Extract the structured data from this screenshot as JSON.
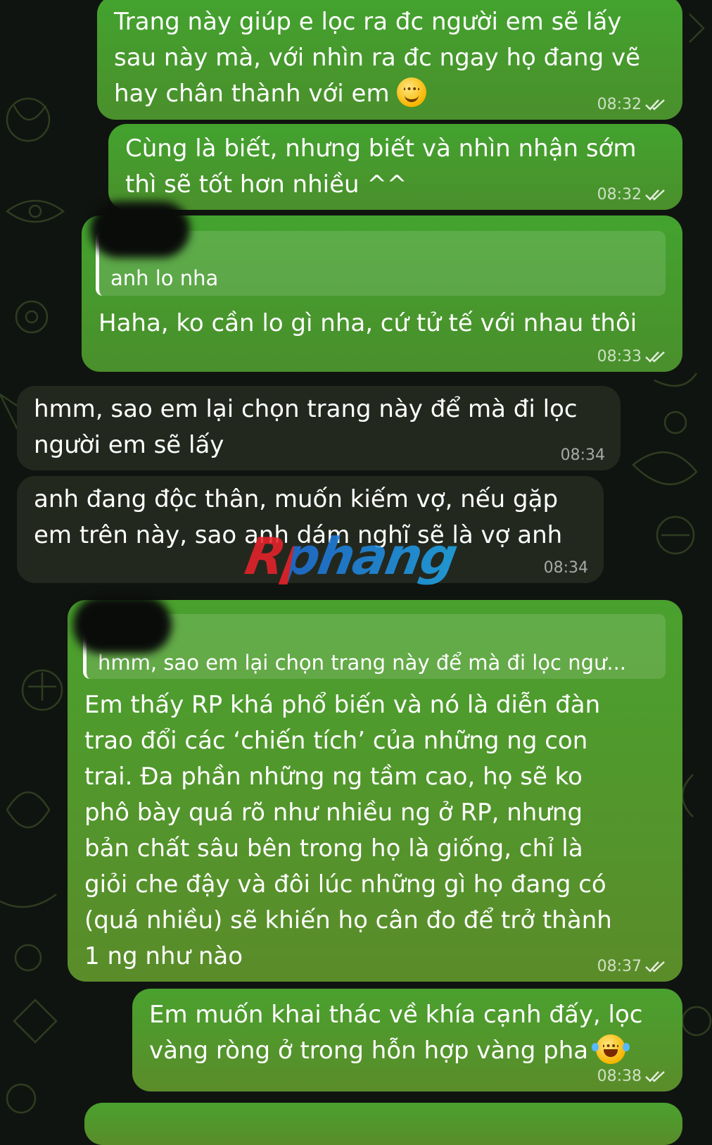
{
  "messages": [
    {
      "id": "m1",
      "direction": "outgoing",
      "text": "Trang này giúp e lọc ra đc người em sẽ lấy\nsau này mà, với nhìn ra đc ngay họ đang vẽ\nhay chân thành với em",
      "emoji": "smiling-face-icon",
      "time": "08:32",
      "status": "read"
    },
    {
      "id": "m2",
      "direction": "outgoing",
      "text": "Cùng là biết, nhưng biết và nhìn nhận sớm\nthì sẽ tốt hơn nhiều ^^",
      "time": "08:32",
      "status": "read"
    },
    {
      "id": "m3",
      "direction": "outgoing",
      "reply_to": "anh lo nha",
      "text": "Haha, ko cần lo gì nha, cứ tử tế với nhau thôi",
      "time": "08:33",
      "status": "read"
    },
    {
      "id": "m4",
      "direction": "incoming",
      "text": "hmm, sao em lại chọn trang này để mà đi lọc\nngười em sẽ lấy",
      "time": "08:34"
    },
    {
      "id": "m5",
      "direction": "incoming",
      "text": "anh đang độc thân, muốn kiếm vợ, nếu gặp\nem trên này, sao anh dám nghĩ sẽ là vợ anh",
      "time": "08:34"
    },
    {
      "id": "m6",
      "direction": "outgoing",
      "reply_to": "hmm, sao em lại chọn trang này để mà đi lọc ngư...",
      "text": "Em thấy RP khá phổ biến và nó là diễn đàn\ntrao đổi các ‘chiến tích’ của những ng con\ntrai. Đa phần những ng tầm cao, họ sẽ ko\nphô bày quá rõ như nhiều ng ở RP, nhưng\nbản chất sâu bên trong họ là giống, chỉ là\ngiỏi che đậy và đôi lúc những gì họ đang có\n(quá nhiều) sẽ khiến họ cân đo để trở thành\n1 ng như nào",
      "time": "08:37",
      "status": "read"
    },
    {
      "id": "m7",
      "direction": "outgoing",
      "text": "Em muốn khai thác về khía cạnh đấy, lọc\nvàng ròng ở trong hỗn hợp vàng pha",
      "emoji": "face-with-tears-of-joy-icon",
      "time": "08:38",
      "status": "read"
    }
  ],
  "watermark": "Rphang",
  "colors": {
    "outgoing": "#43a32e",
    "incoming": "#23281f",
    "background": "#101410"
  }
}
